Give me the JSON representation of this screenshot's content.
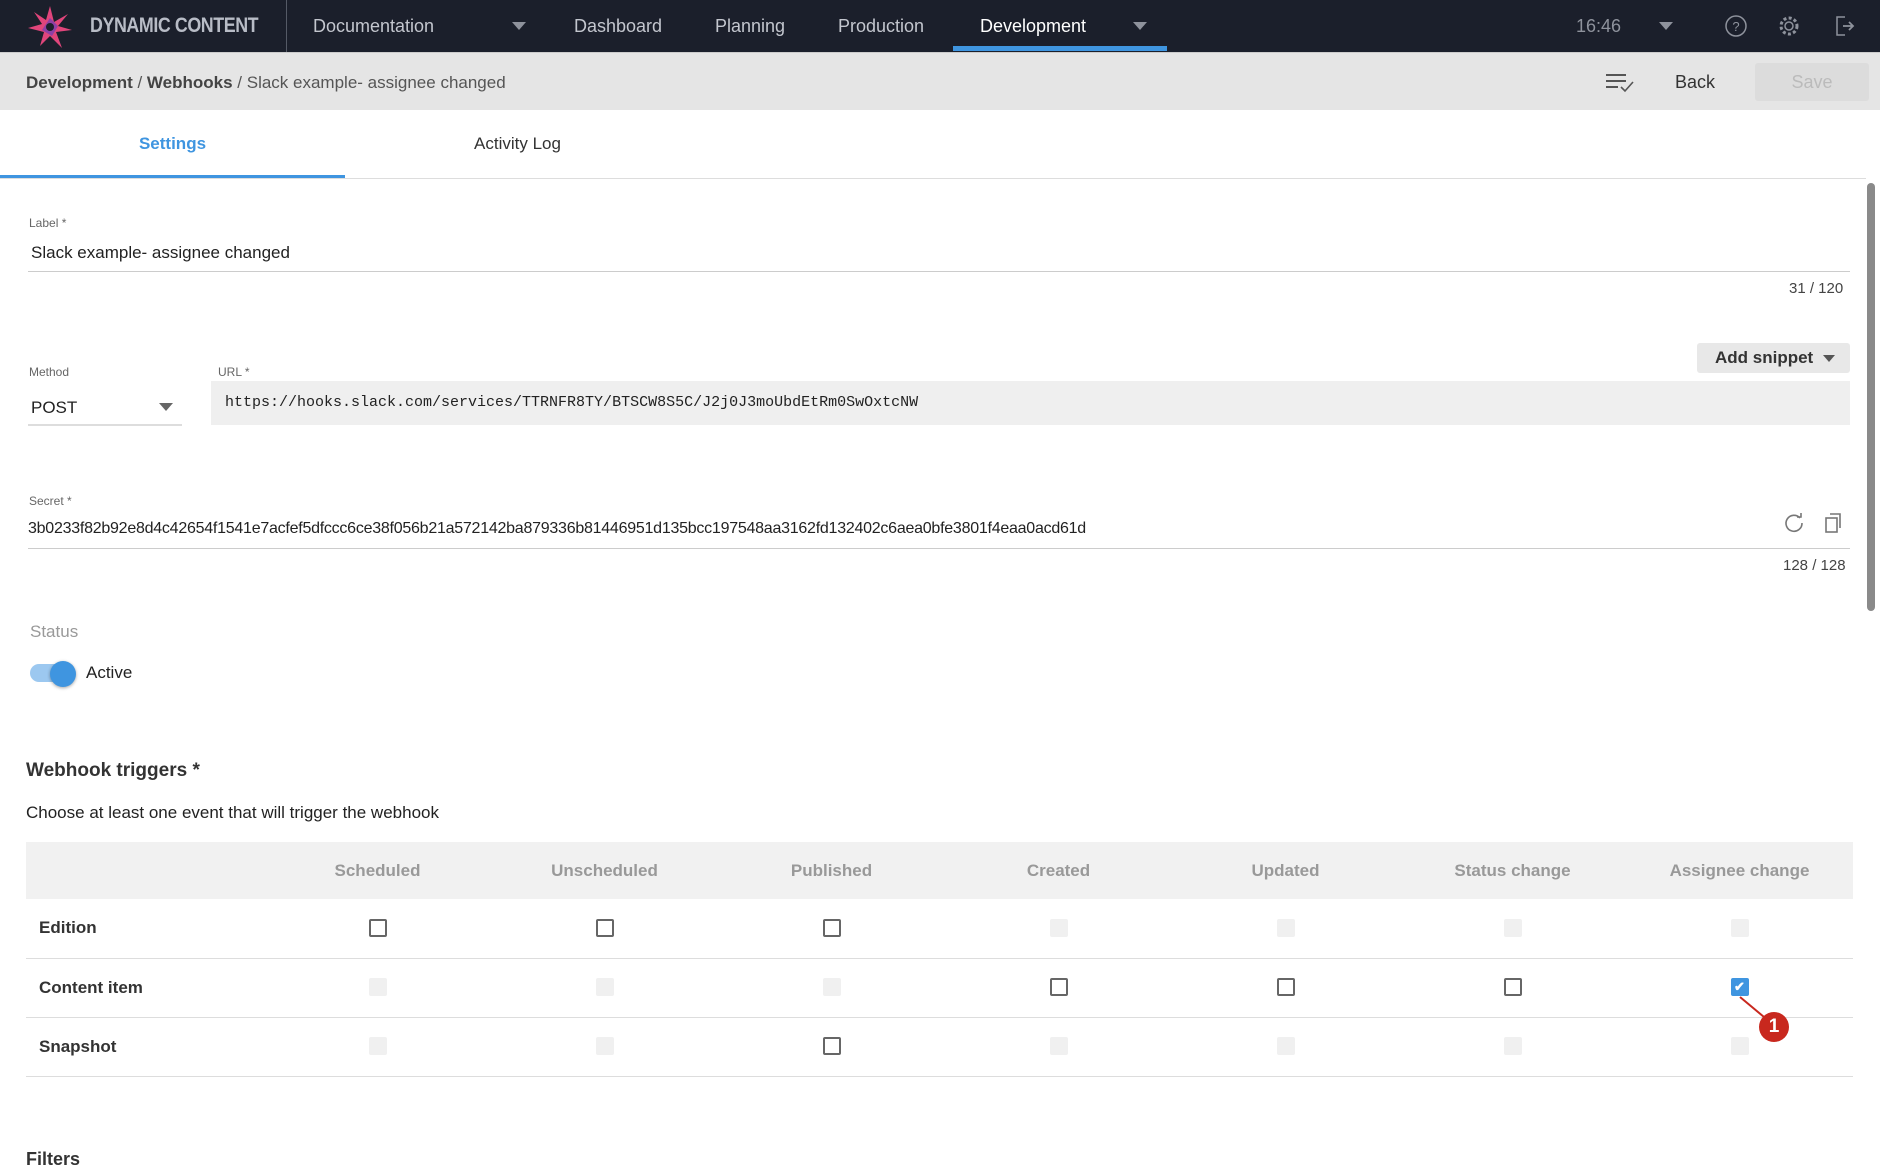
{
  "app": {
    "brand": "DYNAMIC CONTENT",
    "time": "16:46",
    "colors": {
      "accent": "#3f95e0",
      "nav": "#1b1f2b",
      "marker": "#c8281e"
    }
  },
  "nav": {
    "hub": "Documentation",
    "items": [
      "Dashboard",
      "Planning",
      "Production",
      "Development"
    ],
    "active": "Development"
  },
  "breadcrumb": {
    "items": [
      "Development",
      "Webhooks",
      "Slack example- assignee changed"
    ]
  },
  "toolbar": {
    "back": "Back",
    "save": "Save"
  },
  "tabs": [
    "Settings",
    "Activity Log"
  ],
  "form": {
    "label": {
      "label": "Label *",
      "value": "Slack example- assignee changed",
      "counter": "31 / 120"
    },
    "method": {
      "label": "Method",
      "value": "POST"
    },
    "url": {
      "label": "URL *",
      "value": "https://hooks.slack.com/services/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"
    },
    "add_snippet": "Add snippet",
    "secret": {
      "label": "Secret *",
      "value": "3b0233f82b92e8d4c42654f1541e7acfef5dfccc6ce38f056b21a572142ba879336b81446951d135bcc197548aa3162fd132402c6aea0bfe3801f4eaa0acd61d",
      "counter": "128 / 128"
    },
    "status": {
      "label": "Status",
      "value": "Active",
      "on": true
    }
  },
  "triggers": {
    "title": "Webhook triggers *",
    "subtitle": "Choose at least one event that will trigger the webhook",
    "columns": [
      "Scheduled",
      "Unscheduled",
      "Published",
      "Created",
      "Updated",
      "Status change",
      "Assignee change"
    ],
    "rows": [
      {
        "label": "Edition",
        "cells": [
          "enabled",
          "enabled",
          "enabled",
          "disabled",
          "disabled",
          "disabled",
          "disabled"
        ]
      },
      {
        "label": "Content item",
        "cells": [
          "disabled",
          "disabled",
          "disabled",
          "enabled",
          "enabled",
          "enabled",
          "checked"
        ]
      },
      {
        "label": "Snapshot",
        "cells": [
          "disabled",
          "disabled",
          "enabled",
          "disabled",
          "disabled",
          "disabled",
          "disabled"
        ]
      }
    ]
  },
  "filters": {
    "title": "Filters"
  },
  "annotation": "1"
}
